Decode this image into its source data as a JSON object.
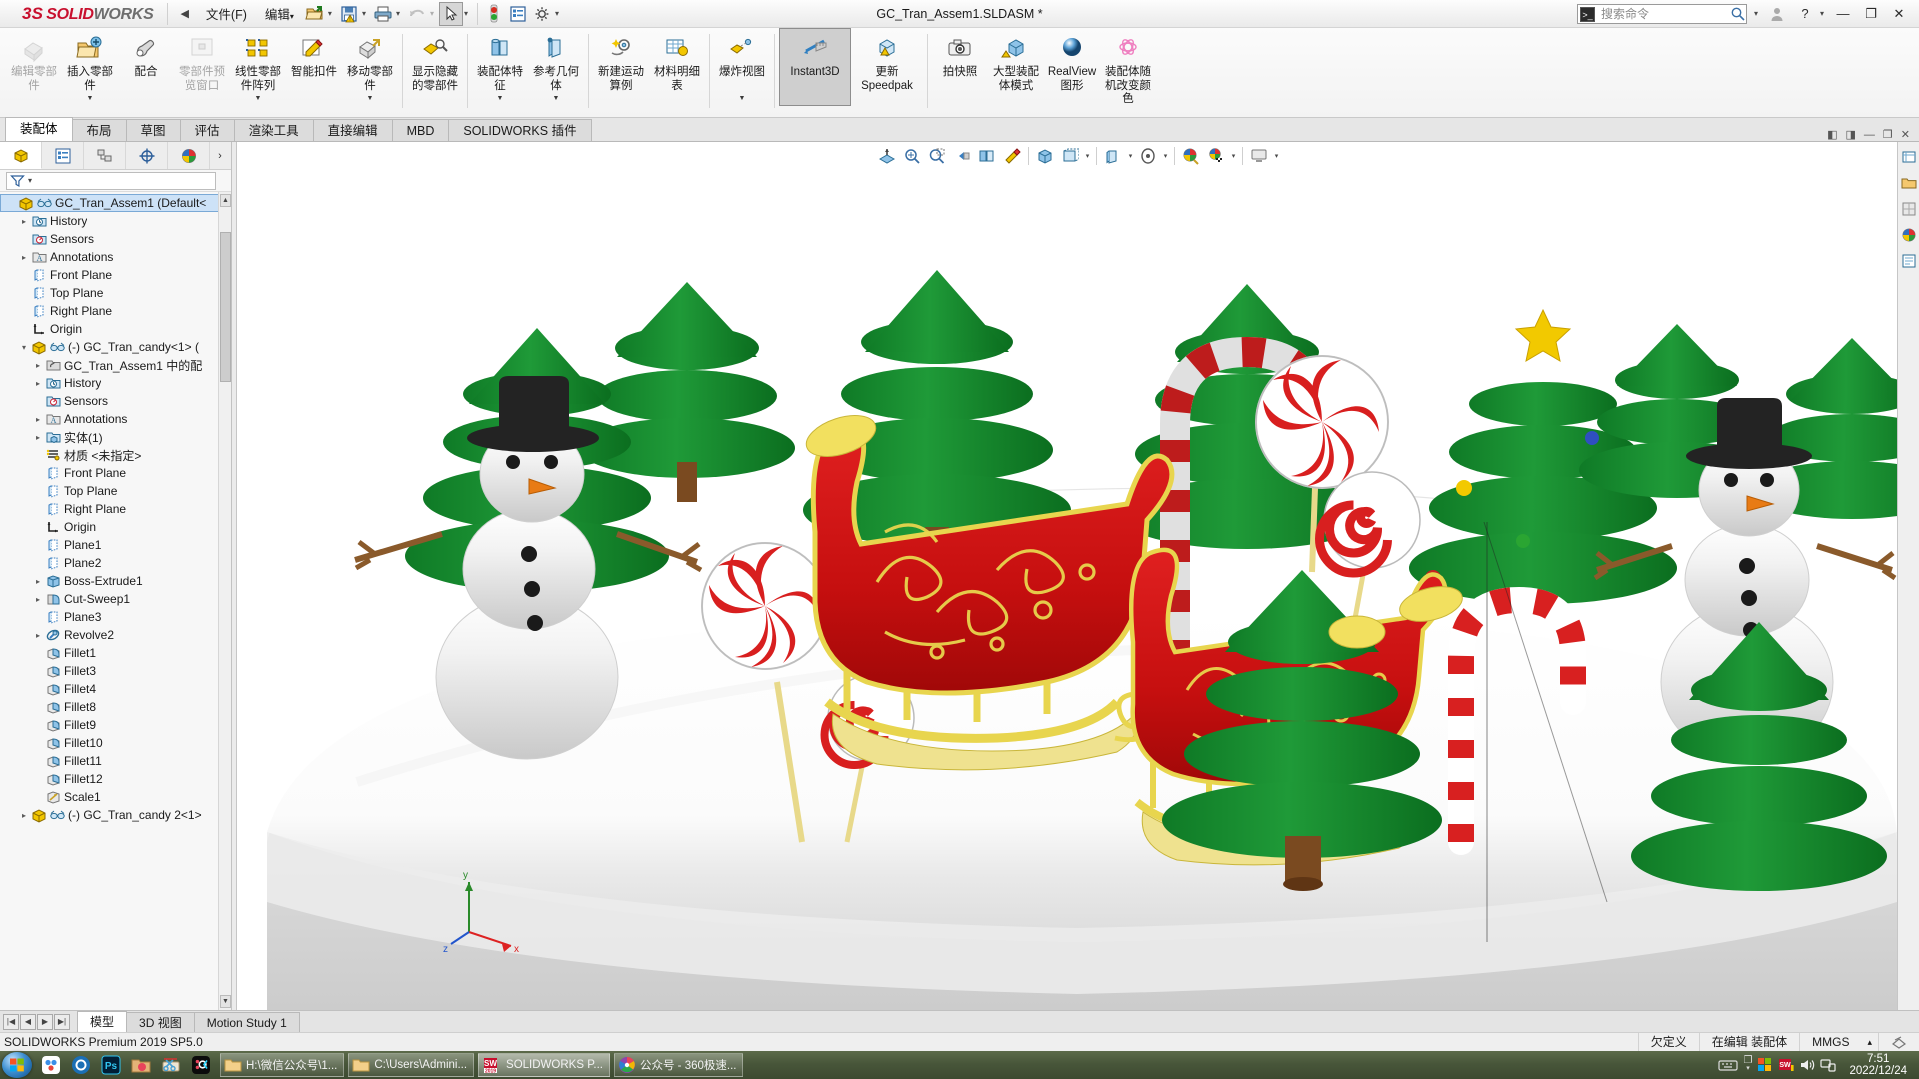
{
  "app": {
    "brand_ds": "3S",
    "brand_solid": "SOLID",
    "brand_works": "WORKS",
    "document_title": "GC_Tran_Assem1.SLDASM *",
    "version_status": "SOLIDWORKS Premium 2019 SP5.0"
  },
  "menu": {
    "collapse_label": "◀",
    "items": [
      {
        "label": "文件(F)",
        "name": "menu-file"
      },
      {
        "label": "编辑",
        "name": "menu-edit",
        "caret": true
      }
    ],
    "toolbar_buttons": [
      {
        "name": "open-file-icon",
        "caret": true
      },
      {
        "name": "save-icon",
        "caret": true
      },
      {
        "name": "print-icon",
        "caret": true
      },
      {
        "name": "undo-icon",
        "caret": true,
        "disabled": true
      },
      {
        "name": "select-cursor-icon",
        "caret": true,
        "active": true
      },
      {
        "name": "rebuild-icon",
        "caret": false
      },
      {
        "name": "options-list-icon",
        "caret": false
      },
      {
        "name": "settings-gear-icon",
        "caret": true
      }
    ]
  },
  "search": {
    "placeholder": "搜索命令",
    "value": ""
  },
  "window_controls": {
    "account": "account-icon",
    "help": "?",
    "help_caret": "▾",
    "minimize": "—",
    "restore": "❐",
    "close": "✕"
  },
  "ribbon": {
    "groups": [
      {
        "items": [
          {
            "label": "编辑零部件",
            "icon": "edit-component-icon",
            "disabled": true,
            "drop": false
          },
          {
            "label": "插入零部件",
            "icon": "insert-component-icon",
            "disabled": false,
            "drop": true
          },
          {
            "label": "配合",
            "icon": "mate-icon",
            "disabled": false,
            "drop": false
          },
          {
            "label": "零部件预览窗口",
            "icon": "component-preview-icon",
            "disabled": true,
            "drop": false
          },
          {
            "label": "线性零部件阵列",
            "icon": "linear-pattern-icon",
            "disabled": false,
            "drop": true
          },
          {
            "label": "智能扣件",
            "icon": "smart-fasteners-icon",
            "disabled": false,
            "drop": false
          },
          {
            "label": "移动零部件",
            "icon": "move-component-icon",
            "disabled": false,
            "drop": true
          }
        ]
      },
      {
        "items": [
          {
            "label": "显示隐藏的零部件",
            "icon": "show-hidden-components-icon",
            "disabled": false,
            "drop": false
          }
        ]
      },
      {
        "items": [
          {
            "label": "装配体特征",
            "icon": "assembly-feature-icon",
            "disabled": false,
            "drop": true
          },
          {
            "label": "参考几何体",
            "icon": "reference-geometry-icon",
            "disabled": false,
            "drop": true
          }
        ]
      },
      {
        "items": [
          {
            "label": "新建运动算例",
            "icon": "new-motion-study-icon",
            "disabled": false,
            "drop": false
          },
          {
            "label": "材料明细表",
            "icon": "bill-of-materials-icon",
            "disabled": false,
            "drop": false
          }
        ]
      },
      {
        "items": [
          {
            "label": "爆炸视图",
            "icon": "exploded-view-icon",
            "disabled": false,
            "drop": true
          }
        ]
      },
      {
        "items": [
          {
            "label": "Instant3D",
            "icon": "instant3d-icon",
            "disabled": false,
            "drop": false,
            "active": true,
            "english": true
          },
          {
            "label": "更新 Speedpak",
            "icon": "update-speedpak-icon",
            "disabled": false,
            "drop": false,
            "english": true
          }
        ]
      },
      {
        "items": [
          {
            "label": "拍快照",
            "icon": "take-snapshot-icon",
            "disabled": false,
            "drop": false
          },
          {
            "label": "大型装配体模式",
            "icon": "large-assembly-mode-icon",
            "disabled": false,
            "drop": false
          },
          {
            "label": "RealView 图形",
            "icon": "realview-graphics-icon",
            "disabled": false,
            "drop": false
          },
          {
            "label": "装配体随机改变颜色",
            "icon": "random-color-icon",
            "disabled": false,
            "drop": false
          }
        ]
      }
    ]
  },
  "command_tabs": {
    "items": [
      "装配体",
      "布局",
      "草图",
      "评估",
      "渲染工具",
      "直接编辑",
      "MBD",
      "SOLIDWORKS 插件"
    ],
    "selected_index": 0,
    "window_buttons": [
      "◧",
      "◨",
      "—",
      "❐",
      "✕"
    ]
  },
  "tree": {
    "tabs": [
      {
        "name": "feature-manager-tab",
        "icon": "assembly-tree-icon",
        "selected": true
      },
      {
        "name": "property-manager-tab",
        "icon": "property-list-icon",
        "selected": false
      },
      {
        "name": "configuration-manager-tab",
        "icon": "configuration-icon",
        "selected": false
      },
      {
        "name": "dimxpert-manager-tab",
        "icon": "dimxpert-icon",
        "selected": false
      },
      {
        "name": "display-manager-tab",
        "icon": "appearance-sphere-icon",
        "selected": false
      }
    ],
    "more_label": "›",
    "filter_placeholder": "",
    "nodes": [
      {
        "label": "GC_Tran_Assem1  (Default<",
        "depth": 0,
        "arrow": "",
        "icon": "assembly-icon",
        "selected": true,
        "glasses": true
      },
      {
        "label": "History",
        "depth": 1,
        "arrow": "▸",
        "icon": "history-icon"
      },
      {
        "label": "Sensors",
        "depth": 1,
        "arrow": "",
        "icon": "sensors-icon"
      },
      {
        "label": "Annotations",
        "depth": 1,
        "arrow": "▸",
        "icon": "annotations-icon"
      },
      {
        "label": "Front Plane",
        "depth": 1,
        "arrow": "",
        "icon": "plane-icon"
      },
      {
        "label": "Top Plane",
        "depth": 1,
        "arrow": "",
        "icon": "plane-icon"
      },
      {
        "label": "Right Plane",
        "depth": 1,
        "arrow": "",
        "icon": "plane-icon"
      },
      {
        "label": "Origin",
        "depth": 1,
        "arrow": "",
        "icon": "origin-icon"
      },
      {
        "label": "(-) GC_Tran_candy<1>  (",
        "depth": 1,
        "arrow": "▾",
        "icon": "part-icon",
        "glasses": true,
        "overflow": true
      },
      {
        "label": "GC_Tran_Assem1 中的配",
        "depth": 2,
        "arrow": "▸",
        "icon": "mates-folder-icon"
      },
      {
        "label": "History",
        "depth": 2,
        "arrow": "▸",
        "icon": "history-icon"
      },
      {
        "label": "Sensors",
        "depth": 2,
        "arrow": "",
        "icon": "sensors-icon"
      },
      {
        "label": "Annotations",
        "depth": 2,
        "arrow": "▸",
        "icon": "annotations-icon"
      },
      {
        "label": "实体(1)",
        "depth": 2,
        "arrow": "▸",
        "icon": "solid-bodies-icon"
      },
      {
        "label": "材质 <未指定>",
        "depth": 2,
        "arrow": "",
        "icon": "material-icon"
      },
      {
        "label": "Front Plane",
        "depth": 2,
        "arrow": "",
        "icon": "plane-icon"
      },
      {
        "label": "Top Plane",
        "depth": 2,
        "arrow": "",
        "icon": "plane-icon"
      },
      {
        "label": "Right Plane",
        "depth": 2,
        "arrow": "",
        "icon": "plane-icon"
      },
      {
        "label": "Origin",
        "depth": 2,
        "arrow": "",
        "icon": "origin-icon"
      },
      {
        "label": "Plane1",
        "depth": 2,
        "arrow": "",
        "icon": "plane-icon"
      },
      {
        "label": "Plane2",
        "depth": 2,
        "arrow": "",
        "icon": "plane-icon"
      },
      {
        "label": "Boss-Extrude1",
        "depth": 2,
        "arrow": "▸",
        "icon": "extrude-icon"
      },
      {
        "label": "Cut-Sweep1",
        "depth": 2,
        "arrow": "▸",
        "icon": "cut-sweep-icon"
      },
      {
        "label": "Plane3",
        "depth": 2,
        "arrow": "",
        "icon": "plane-icon"
      },
      {
        "label": "Revolve2",
        "depth": 2,
        "arrow": "▸",
        "icon": "revolve-icon"
      },
      {
        "label": "Fillet1",
        "depth": 2,
        "arrow": "",
        "icon": "fillet-icon"
      },
      {
        "label": "Fillet3",
        "depth": 2,
        "arrow": "",
        "icon": "fillet-icon"
      },
      {
        "label": "Fillet4",
        "depth": 2,
        "arrow": "",
        "icon": "fillet-icon"
      },
      {
        "label": "Fillet8",
        "depth": 2,
        "arrow": "",
        "icon": "fillet-icon"
      },
      {
        "label": "Fillet9",
        "depth": 2,
        "arrow": "",
        "icon": "fillet-icon"
      },
      {
        "label": "Fillet10",
        "depth": 2,
        "arrow": "",
        "icon": "fillet-icon"
      },
      {
        "label": "Fillet11",
        "depth": 2,
        "arrow": "",
        "icon": "fillet-icon"
      },
      {
        "label": "Fillet12",
        "depth": 2,
        "arrow": "",
        "icon": "fillet-icon"
      },
      {
        "label": "Scale1",
        "depth": 2,
        "arrow": "",
        "icon": "scale-icon"
      },
      {
        "label": "(-) GC_Tran_candy 2<1>",
        "depth": 1,
        "arrow": "▸",
        "icon": "part-icon",
        "glasses": true
      }
    ]
  },
  "viewport": {
    "toolbar_buttons": [
      {
        "name": "section-view-icon",
        "caret": false
      },
      {
        "name": "zoom-to-fit-icon",
        "caret": false
      },
      {
        "name": "zoom-to-area-icon",
        "caret": false
      },
      {
        "name": "previous-view-icon",
        "caret": false
      },
      {
        "name": "view-orientation-icon",
        "caret": false
      },
      {
        "name": "section-cut-icon",
        "caret": false
      },
      {
        "name": "view-cube-icon",
        "caret": false
      },
      {
        "name": "display-style-icon",
        "caret": true
      },
      {
        "name": "hide-show-items-icon",
        "caret": true
      },
      {
        "name": "edit-appearance-icon",
        "caret": true
      },
      {
        "name": "apply-scene-icon",
        "caret": true
      },
      {
        "name": "view-settings-icon",
        "caret": true
      },
      {
        "name": "viewport-layout-icon",
        "caret": true
      }
    ],
    "triad_labels": {
      "x": "x",
      "y": "y",
      "z": "z"
    },
    "scene_name": "christmas-candy-assembly-3d-scene"
  },
  "document_tabs": {
    "nav": [
      "|◀",
      "◀",
      "▶",
      "▶|"
    ],
    "items": [
      "模型",
      "3D 视图",
      "Motion Study 1"
    ],
    "selected_index": 0
  },
  "status_bar": {
    "left_text": "SOLIDWORKS Premium 2019 SP5.0",
    "cells": [
      "欠定义",
      "在编辑 装配体",
      "MMGS",
      "▴"
    ],
    "right_icon": "overlay-icon"
  },
  "taskbar": {
    "start": "windows-start-orb",
    "quick_launch": [
      {
        "name": "baidu-netdisk-icon",
        "color": "#ffffff"
      },
      {
        "name": "camera360-icon",
        "color": "#1b6fb5"
      },
      {
        "name": "photoshop-icon",
        "color": "#001e36"
      },
      {
        "name": "photo-folder-icon",
        "color": "#d6a06a"
      },
      {
        "name": "snipping-tool-icon",
        "color": "#e8e0d0"
      },
      {
        "name": "okcoin-icon",
        "color": "#0b0b0b"
      }
    ],
    "tasks": [
      {
        "label": "H:\\微信公众号\\1...",
        "icon": "folder-icon",
        "active": false
      },
      {
        "label": "C:\\Users\\Admini...",
        "icon": "folder-icon",
        "active": false
      },
      {
        "label": "SOLIDWORKS P...",
        "icon": "solidworks-2019-icon",
        "active": true
      },
      {
        "label": "公众号 - 360极速...",
        "icon": "browser-360-icon",
        "active": false
      }
    ],
    "tray": [
      {
        "name": "keyboard-icon"
      },
      {
        "name": "show-hidden-icons-icon"
      },
      {
        "name": "color-squares-icon"
      },
      {
        "name": "solidworks-tray-icon"
      },
      {
        "name": "volume-icon"
      },
      {
        "name": "network-icon"
      }
    ],
    "clock_time": "7:51",
    "clock_date": "2022/12/24"
  },
  "colors": {
    "brand_red": "#c8102e",
    "tree_select": "#cde2f7",
    "ribbon_bg": "#f3f3f3",
    "taskbar": "#48563a",
    "tree_candy_red": "#e01b24",
    "tree_green": "#1f8b36"
  }
}
